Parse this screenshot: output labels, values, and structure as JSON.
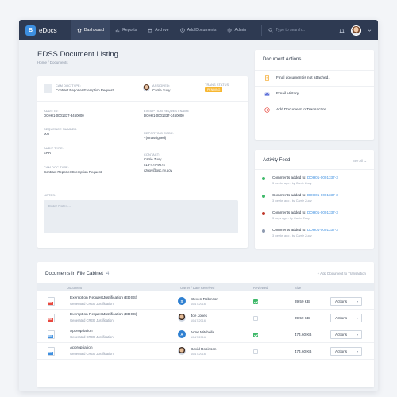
{
  "app": {
    "logo_letter": "B",
    "name": "eDocs"
  },
  "nav": [
    {
      "label": "Dashboard",
      "icon": "home-icon"
    },
    {
      "label": "Reports",
      "icon": "bar-chart-icon"
    },
    {
      "label": "Archive",
      "icon": "archive-icon"
    },
    {
      "label": "Add Documents",
      "icon": "plus-circle-icon"
    },
    {
      "label": "Admin",
      "icon": "gear-icon"
    }
  ],
  "search": {
    "placeholder": "Type to search..."
  },
  "page": {
    "title": "EDSS Document Listing",
    "breadcrumb": "Home / Documents"
  },
  "doc": {
    "type_label": "CAM DOC TYPE:",
    "type_value": "Contract Reporter Exemption Request",
    "assigned_label": "ASSIGNED:",
    "assigned_value": "Carrie Zuoy",
    "status_label": "TRANS STATUS:",
    "status_value": "PENDING",
    "audit_label": "AUDIT ID:",
    "audit_value": "DOH01-0001337-3460000",
    "exemption_label": "EXEMPTION REQUEST NAME",
    "exemption_value": "DOH01-0001337-3460000",
    "sequence_label": "SEQUENCE NUMBER:",
    "sequence_value": "000",
    "reporting_label": "REPORTING CODE:",
    "reporting_value": "- (Unassigned)",
    "audit_type_label": "AUDIT TYPE:",
    "audit_type_value": "ERR",
    "contact_label": "CONTACT:",
    "contact_name": "Carrie Zuoy",
    "contact_phone": "518-474-9674",
    "contact_email": "czuoy@osc.ny.gov",
    "cam_type_label": "CAM DOC TYPE:",
    "cam_type_value": "Contract Reporter Exemption Request",
    "notes_label": "NOTES:",
    "notes_placeholder": "Enter Notes..."
  },
  "actions": {
    "title": "Document Actions",
    "items": [
      {
        "label": "Final document is not attached..",
        "icon": "document-icon",
        "color": "#f5a623"
      },
      {
        "label": "Email History",
        "icon": "mail-icon",
        "color": "#5b6fd8"
      },
      {
        "label": "Add Document to Transaction",
        "icon": "plus-circle-icon",
        "color": "#e8493f"
      }
    ]
  },
  "feed": {
    "title": "Activity Feed",
    "see_all": "See All",
    "items": [
      {
        "prefix": "Comments added to:",
        "link": "DOH01-0001337-3",
        "meta": "3 weeks ago - by Carrie Zuoy",
        "dot_color": "#3fb96a"
      },
      {
        "prefix": "Comments added to:",
        "link": "DOH01-0001337-3",
        "meta": "3 weeks ago - by Carrie Zuoy",
        "dot_color": "#3fb96a"
      },
      {
        "prefix": "Comments added to:",
        "link": "DOH01-0001337-3",
        "meta": "3 days ago - by Carrie Zuoy",
        "dot_color": "#c0392b"
      },
      {
        "prefix": "Comments added to:",
        "link": "DOH01-0001337-3",
        "meta": "3 weeks ago - by Carrie Zuoy",
        "dot_color": "#8e9ab0"
      }
    ]
  },
  "files": {
    "title": "Documents In File Cabinet",
    "count": "4",
    "add_link": "+ Add Document to Transaction",
    "columns": [
      "Document",
      "Owner / Date Received",
      "Reviewed",
      "Size"
    ],
    "rows": [
      {
        "name": "Exemption RequestJustification (EDSS)",
        "sub": "Generated CRER Justification",
        "file_type": "PDF",
        "file_color": "#e8493f",
        "owner": "Steven Robinson",
        "owner_initial": "S",
        "owner_color": "#2f80d1",
        "owner_photo": false,
        "date": "10/17/2016",
        "reviewed": true,
        "size": "39.59 KB",
        "action": "Actions"
      },
      {
        "name": "Exemption RequestJustification (EDSS)",
        "sub": "Generated CRER Justification",
        "file_type": "PDF",
        "file_color": "#e8493f",
        "owner": "Joe Jones",
        "owner_initial": "",
        "owner_color": "#3b2a22",
        "owner_photo": true,
        "date": "10/17/2016",
        "reviewed": false,
        "size": "39.59 KB",
        "action": "Actions"
      },
      {
        "name": "Appropriation",
        "sub": "Generated CRER Justification",
        "file_type": "DOC",
        "file_color": "#3d8fe0",
        "owner": "Anne Mitchelle",
        "owner_initial": "A",
        "owner_color": "#2f80d1",
        "owner_photo": false,
        "date": "10/17/2016",
        "reviewed": true,
        "size": "474.60 KB",
        "action": "Actions"
      },
      {
        "name": "Appropriation",
        "sub": "Generated CRER Justification",
        "file_type": "DOC",
        "file_color": "#3d8fe0",
        "owner": "David Robinson",
        "owner_initial": "",
        "owner_color": "#3b2a22",
        "owner_photo": true,
        "date": "10/17/2016",
        "reviewed": false,
        "size": "474.60 KB",
        "action": "Actions"
      }
    ]
  }
}
